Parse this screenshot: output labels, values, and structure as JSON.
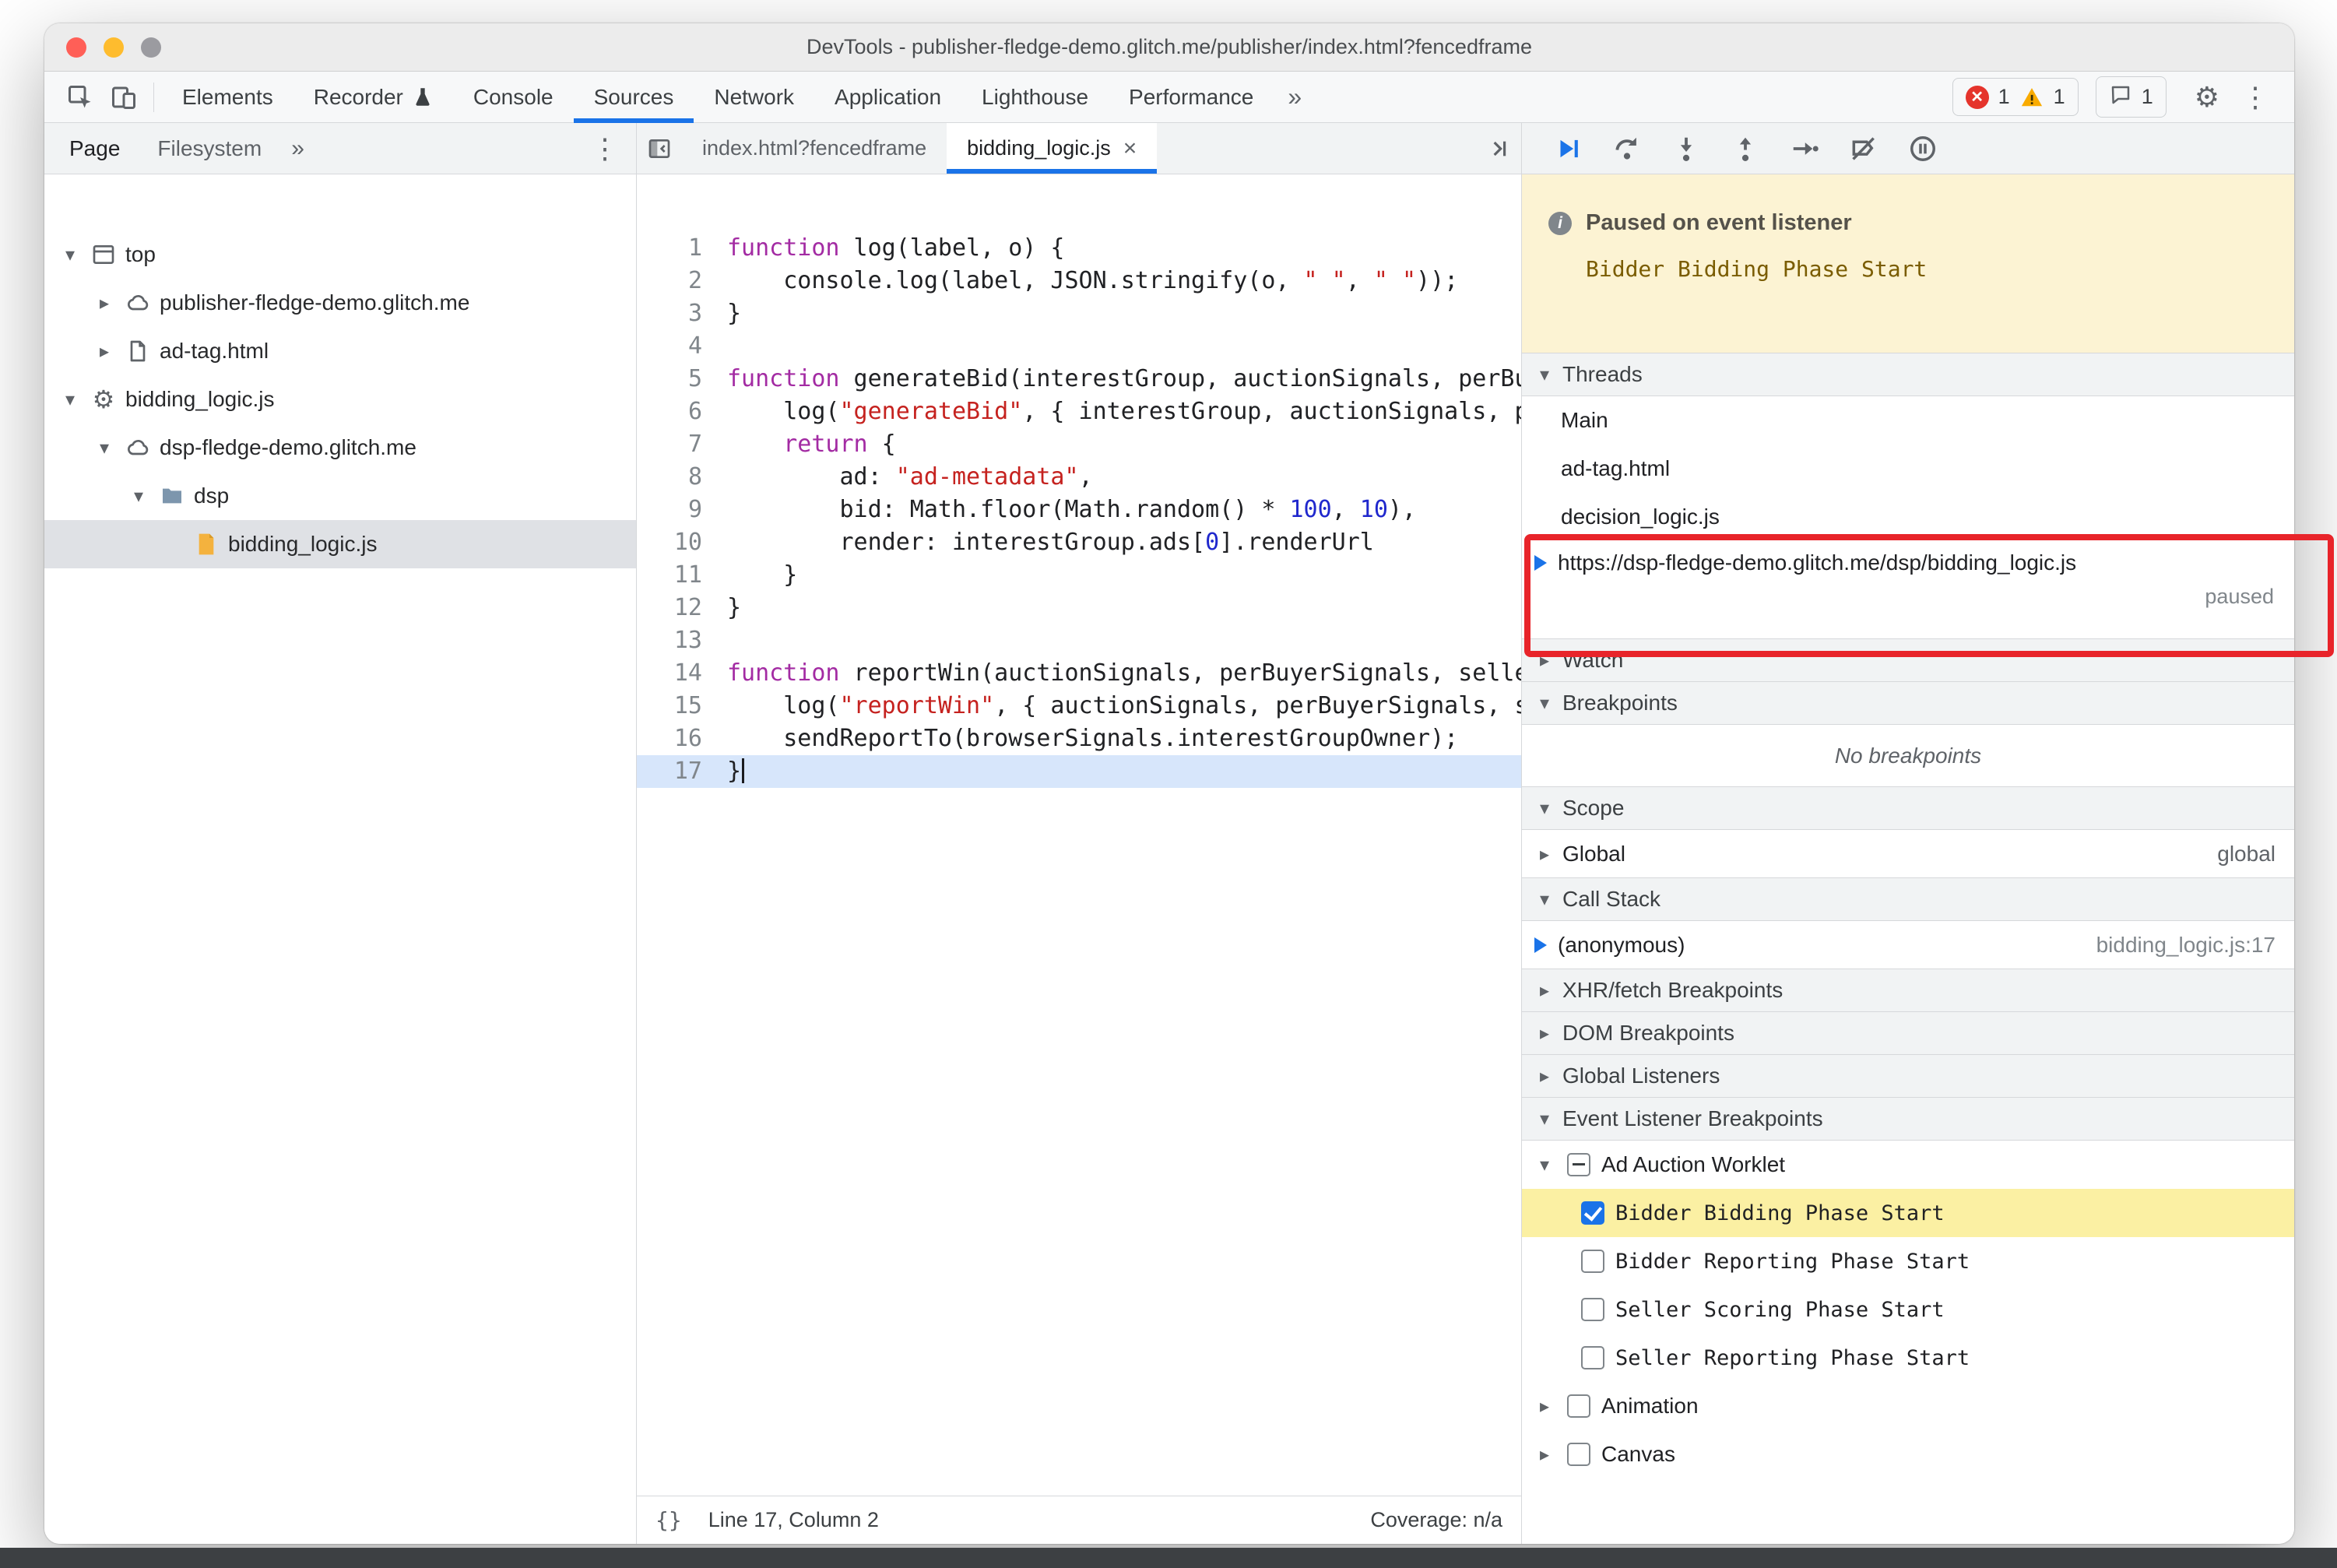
{
  "window": {
    "title": "DevTools - publisher-fledge-demo.glitch.me/publisher/index.html?fencedframe"
  },
  "colors": {
    "accent": "#1a73e8",
    "annotation_red": "#e8242a",
    "error_red": "#e5342c",
    "warning_yellow": "#f9ab00",
    "paused_banner_bg": "#fcf3d3",
    "event_highlight_yellow": "#fbf0a3"
  },
  "icons": {
    "gear": "⚙",
    "kebab": "⋮",
    "expanded": "▾",
    "collapsed": "▸"
  },
  "main_toolbar": {
    "tabs": [
      {
        "label": "Elements"
      },
      {
        "label": "Recorder"
      },
      {
        "label": "Console"
      },
      {
        "label": "Sources",
        "active": true
      },
      {
        "label": "Network"
      },
      {
        "label": "Application"
      },
      {
        "label": "Lighthouse"
      },
      {
        "label": "Performance"
      }
    ],
    "more_tabs_label": "»",
    "error_count": "1",
    "warning_count": "1",
    "issue_count": "1"
  },
  "navigator": {
    "tabs": [
      {
        "label": "Page",
        "active": true
      },
      {
        "label": "Filesystem"
      }
    ],
    "more_label": "»",
    "tree": [
      {
        "label": "top",
        "icon": "frame-icon",
        "depth": 0,
        "arrow": "expanded"
      },
      {
        "label": "publisher-fledge-demo.glitch.me",
        "icon": "cloud-icon",
        "depth": 1,
        "arrow": "collapsed"
      },
      {
        "label": "ad-tag.html",
        "icon": "document-icon",
        "depth": 1,
        "arrow": "collapsed"
      },
      {
        "label": "bidding_logic.js",
        "icon": "worklet-icon",
        "depth": 0,
        "arrow": "expanded"
      },
      {
        "label": "dsp-fledge-demo.glitch.me",
        "icon": "cloud-icon",
        "depth": 1,
        "arrow": "expanded"
      },
      {
        "label": "dsp",
        "icon": "folder-icon",
        "depth": 2,
        "arrow": "expanded"
      },
      {
        "label": "bidding_logic.js",
        "icon": "script-icon",
        "depth": 3,
        "arrow": "none",
        "selected": true
      }
    ]
  },
  "editor": {
    "tabs": [
      {
        "label": "index.html?fencedframe"
      },
      {
        "label": "bidding_logic.js",
        "active": true,
        "close": "×"
      }
    ],
    "code": [
      {
        "line": 1,
        "tokens": [
          [
            "k",
            "function"
          ],
          [
            "d",
            " log(label, o) {"
          ]
        ]
      },
      {
        "line": 2,
        "tokens": [
          [
            "d",
            "    console.log(label, JSON.stringify(o, "
          ],
          [
            "s",
            "\" \""
          ],
          [
            "d",
            ", "
          ],
          [
            "s",
            "\" \""
          ],
          [
            "d",
            "));"
          ]
        ]
      },
      {
        "line": 3,
        "tokens": [
          [
            "d",
            "}"
          ]
        ]
      },
      {
        "line": 4,
        "tokens": []
      },
      {
        "line": 5,
        "tokens": [
          [
            "k",
            "function"
          ],
          [
            "d",
            " generateBid(interestGroup, auctionSignals, perBuyerSignals, trustedBiddingSignals, browserSignals) {"
          ]
        ]
      },
      {
        "line": 6,
        "tokens": [
          [
            "d",
            "    log("
          ],
          [
            "s",
            "\"generateBid\""
          ],
          [
            "d",
            ", { interestGroup, auctionSignals, perBuyerSignals, trustedBiddingSignals, browserSignals });"
          ]
        ]
      },
      {
        "line": 7,
        "tokens": [
          [
            "d",
            "    "
          ],
          [
            "k",
            "return"
          ],
          [
            "d",
            " {"
          ]
        ]
      },
      {
        "line": 8,
        "tokens": [
          [
            "d",
            "        ad: "
          ],
          [
            "s",
            "\"ad-metadata\""
          ],
          [
            "d",
            ","
          ]
        ]
      },
      {
        "line": 9,
        "tokens": [
          [
            "d",
            "        bid: Math.floor(Math.random() * "
          ],
          [
            "n",
            "100"
          ],
          [
            "d",
            ", "
          ],
          [
            "n",
            "10"
          ],
          [
            "d",
            "),"
          ]
        ]
      },
      {
        "line": 10,
        "tokens": [
          [
            "d",
            "        render: interestGroup.ads["
          ],
          [
            "n",
            "0"
          ],
          [
            "d",
            "].renderUrl"
          ]
        ]
      },
      {
        "line": 11,
        "tokens": [
          [
            "d",
            "    }"
          ]
        ]
      },
      {
        "line": 12,
        "tokens": [
          [
            "d",
            "}"
          ]
        ]
      },
      {
        "line": 13,
        "tokens": []
      },
      {
        "line": 14,
        "tokens": [
          [
            "k",
            "function"
          ],
          [
            "d",
            " reportWin(auctionSignals, perBuyerSignals, sellerSignals, browserSignals) {"
          ]
        ]
      },
      {
        "line": 15,
        "tokens": [
          [
            "d",
            "    log("
          ],
          [
            "s",
            "\"reportWin\""
          ],
          [
            "d",
            ", { auctionSignals, perBuyerSignals, sellerSignals, browserSignals });"
          ]
        ]
      },
      {
        "line": 16,
        "tokens": [
          [
            "d",
            "    sendReportTo(browserSignals.interestGroupOwner);"
          ]
        ]
      },
      {
        "line": 17,
        "tokens": [
          [
            "d",
            "}"
          ]
        ],
        "highlighted": true
      }
    ],
    "status_bar": {
      "brackets": "{}",
      "position": "Line 17, Column 2",
      "coverage": "Coverage: n/a"
    }
  },
  "debugger": {
    "paused_banner": {
      "title": "Paused on event listener",
      "event": "Bidder Bidding Phase Start"
    },
    "threads": {
      "title": "Threads",
      "items": [
        "Main",
        "ad-tag.html",
        "decision_logic.js"
      ],
      "current": {
        "url": "https://dsp-fledge-demo.glitch.me/dsp/bidding_logic.js",
        "status": "paused"
      }
    },
    "watch": {
      "title": "Watch"
    },
    "breakpoints": {
      "title": "Breakpoints",
      "empty": "No breakpoints"
    },
    "scope": {
      "title": "Scope",
      "items": [
        {
          "label": "Global",
          "value": "global"
        }
      ]
    },
    "call_stack": {
      "title": "Call Stack",
      "frames": [
        {
          "label": "(anonymous)",
          "location": "bidding_logic.js:17"
        }
      ]
    },
    "xhr_breakpoints": {
      "title": "XHR/fetch Breakpoints"
    },
    "dom_breakpoints": {
      "title": "DOM Breakpoints"
    },
    "global_listeners": {
      "title": "Global Listeners"
    },
    "event_listener_breakpoints": {
      "title": "Event Listener Breakpoints",
      "groups": [
        {
          "label": "Ad Auction Worklet",
          "state": "indeterminate",
          "expanded": true,
          "children": [
            {
              "label": "Bidder Bidding Phase Start",
              "checked": true,
              "highlighted": true
            },
            {
              "label": "Bidder Reporting Phase Start",
              "checked": false
            },
            {
              "label": "Seller Scoring Phase Start",
              "checked": false
            },
            {
              "label": "Seller Reporting Phase Start",
              "checked": false
            }
          ]
        },
        {
          "label": "Animation",
          "state": "unchecked",
          "expanded": false,
          "children": []
        },
        {
          "label": "Canvas",
          "state": "unchecked",
          "expanded": false,
          "children": []
        }
      ]
    }
  },
  "annotation": {
    "shape": "red-highlight-box",
    "color": "#e8242a"
  }
}
